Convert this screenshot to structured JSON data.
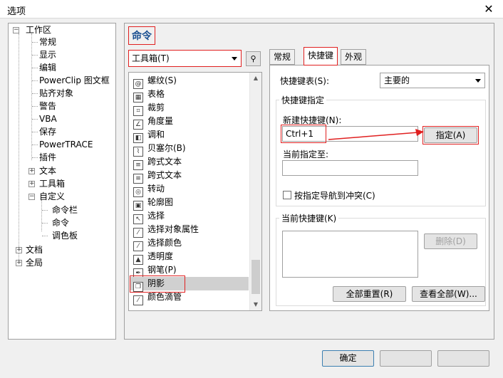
{
  "window": {
    "title": "选项",
    "close_glyph": "✕"
  },
  "tree": {
    "workspace": "工作区",
    "workspace_children": [
      "常规",
      "显示",
      "编辑",
      "PowerClip 图文框",
      "贴齐对象",
      "警告",
      "VBA",
      "保存",
      "PowerTRACE",
      "插件"
    ],
    "text": "文本",
    "toolbox": "工具箱",
    "customize": "自定义",
    "customize_children": [
      "命令栏",
      "命令",
      "调色板"
    ],
    "document": "文档",
    "global": "全局"
  },
  "main": {
    "heading": "命令",
    "category_select": "工具箱(T)",
    "find_icon_glyph": "⚲"
  },
  "commands": [
    {
      "label": "螺纹(S)",
      "icon": "spiral-icon",
      "glyph": "@"
    },
    {
      "label": "表格",
      "icon": "table-icon",
      "glyph": "▦"
    },
    {
      "label": "裁剪",
      "icon": "crop-icon",
      "glyph": "⌗"
    },
    {
      "label": "角度量",
      "icon": "angle-icon",
      "glyph": "∠"
    },
    {
      "label": "调和",
      "icon": "blend-icon",
      "glyph": "◧"
    },
    {
      "label": "贝塞尔(B)",
      "icon": "bezier-icon",
      "glyph": "⌇"
    },
    {
      "label": "跨式文本",
      "icon": "text-icon",
      "glyph": "≡"
    },
    {
      "label": "跨式文本",
      "icon": "text-icon",
      "glyph": "≡"
    },
    {
      "label": "转动",
      "icon": "twirl-icon",
      "glyph": "◎"
    },
    {
      "label": "轮廓图",
      "icon": "contour-icon",
      "glyph": "▣"
    },
    {
      "label": "选择",
      "icon": "pointer-icon",
      "glyph": "↖"
    },
    {
      "label": "选择对象属性",
      "icon": "eyedropper-icon",
      "glyph": "⁄"
    },
    {
      "label": "选择颜色",
      "icon": "eyedropper-icon",
      "glyph": "⁄"
    },
    {
      "label": "透明度",
      "icon": "transparency-icon",
      "glyph": "▲"
    },
    {
      "label": "钢笔(P)",
      "icon": "pen-icon",
      "glyph": "✒"
    },
    {
      "label": "阴影",
      "icon": "shadow-icon",
      "glyph": "❐"
    },
    {
      "label": "颜色滴管",
      "icon": "color-eyedropper-icon",
      "glyph": "⁄"
    }
  ],
  "scroll": {
    "up": "▲",
    "down": "▼"
  },
  "tabs": [
    "常规",
    "快捷键",
    "外观"
  ],
  "shortcuts": {
    "table_label": "快捷键表(S):",
    "table_value": "主要的",
    "assign_group": "快捷键指定",
    "new_label": "新建快捷键(N):",
    "new_value": "Ctrl+1",
    "assign_button": "指定(A)",
    "current_assign_label": "当前指定至:",
    "nav_conflict_label": "按指定导航到冲突(C)",
    "current_group": "当前快捷键(K)",
    "delete_button": "删除(D)",
    "reset_all_button": "全部重置(R)",
    "view_all_button": "查看全部(W)..."
  },
  "footer": {
    "ok": "确定"
  }
}
